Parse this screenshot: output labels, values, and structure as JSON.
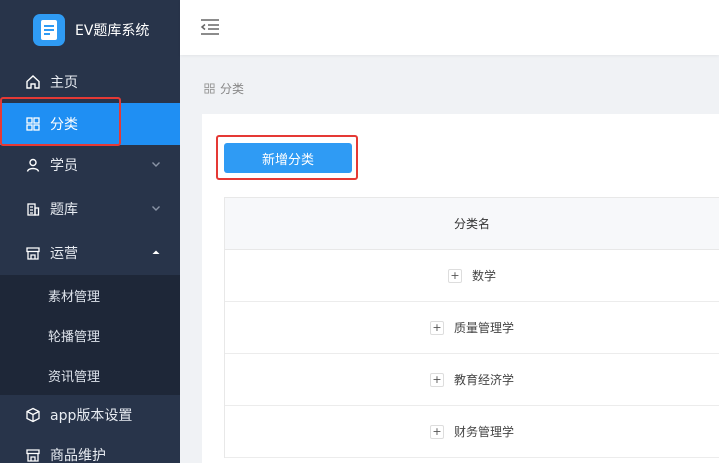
{
  "app": {
    "title": "EV题库系统"
  },
  "sidebar": {
    "items": [
      {
        "label": "主页",
        "icon": "home-icon"
      },
      {
        "label": "分类",
        "icon": "grid-icon",
        "active": true
      },
      {
        "label": "学员",
        "icon": "user-icon"
      },
      {
        "label": "题库",
        "icon": "building-icon"
      },
      {
        "label": "运营",
        "icon": "shop-icon",
        "expanded": true
      },
      {
        "label": "app版本设置",
        "icon": "cube-icon"
      },
      {
        "label": "商品维护",
        "icon": "shop-icon"
      }
    ],
    "submenu": [
      {
        "label": "素材管理"
      },
      {
        "label": "轮播管理"
      },
      {
        "label": "资讯管理"
      }
    ]
  },
  "breadcrumb": {
    "current": "分类"
  },
  "toolbar": {
    "add_label": "新增分类"
  },
  "table": {
    "headers": [
      "分类名"
    ],
    "rows": [
      {
        "name": "数学"
      },
      {
        "name": "质量管理学"
      },
      {
        "name": "教育经济学"
      },
      {
        "name": "财务管理学"
      }
    ]
  },
  "colors": {
    "sidebar_bg": "#28344a",
    "submenu_bg": "#1e2738",
    "accent": "#1f8ff3",
    "annotation": "#e53935"
  }
}
